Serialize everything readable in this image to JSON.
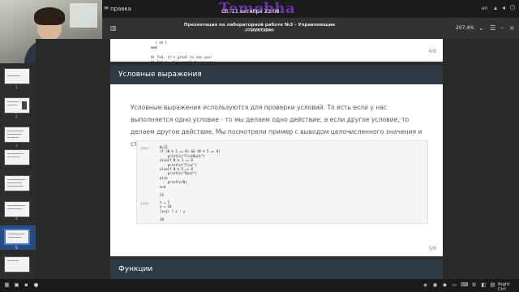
{
  "system": {
    "menu_label": "правка",
    "brand": "Temebha",
    "clock": "Сб, 11 октября 23:08",
    "lang": "en"
  },
  "toolbar": {
    "doc_title": "Презентация по лабораторной работе №3 - Управляющие структуры",
    "doc_file": "presentation.pdf",
    "zoom": "207,4%"
  },
  "sidebar": {
    "pages": [
      "1",
      "2",
      "3",
      "4",
      "5"
    ],
    "active_page": "5"
  },
  "prev_page": {
    "code_lines": [
      "  } ≡≡ }",
      "end",
      "",
      "Hi Ted, it's great to see you!",
      "Hi Robyn, it's great to see you!"
    ],
    "page_number": "4/8"
  },
  "slide": {
    "title": "Условные выражения",
    "paragraph": "Условные выражения используются для проверки условий. То есть если у нас выполняется одно условие - то мы делаем одно действие, а если другое условие, то делаем другое действие. Мы посмотрели пример с выводом целочисленного значения и строкового.",
    "page_number": "5/8",
    "cells": [
      {
        "prompt": "[23]:",
        "code": "N=22\nif (N % 3 == 0) && (N % 5 == 0)\n    println(\"FizzBuzz\")\nelseif N % 3 == 0\n    println(\"Fizz\")\nelseif N % 5 == 0\n    println(\"Buzz\")\nelse\n    println(N)\nend",
        "output": "22"
      },
      {
        "prompt": "[24]:",
        "code": "x = 5\ny = 10\n(x>y) ? x : y",
        "output": "10"
      }
    ]
  },
  "next_slide": {
    "title": "Функции"
  },
  "taskbar": {
    "right_label": "Right Ctrl"
  }
}
